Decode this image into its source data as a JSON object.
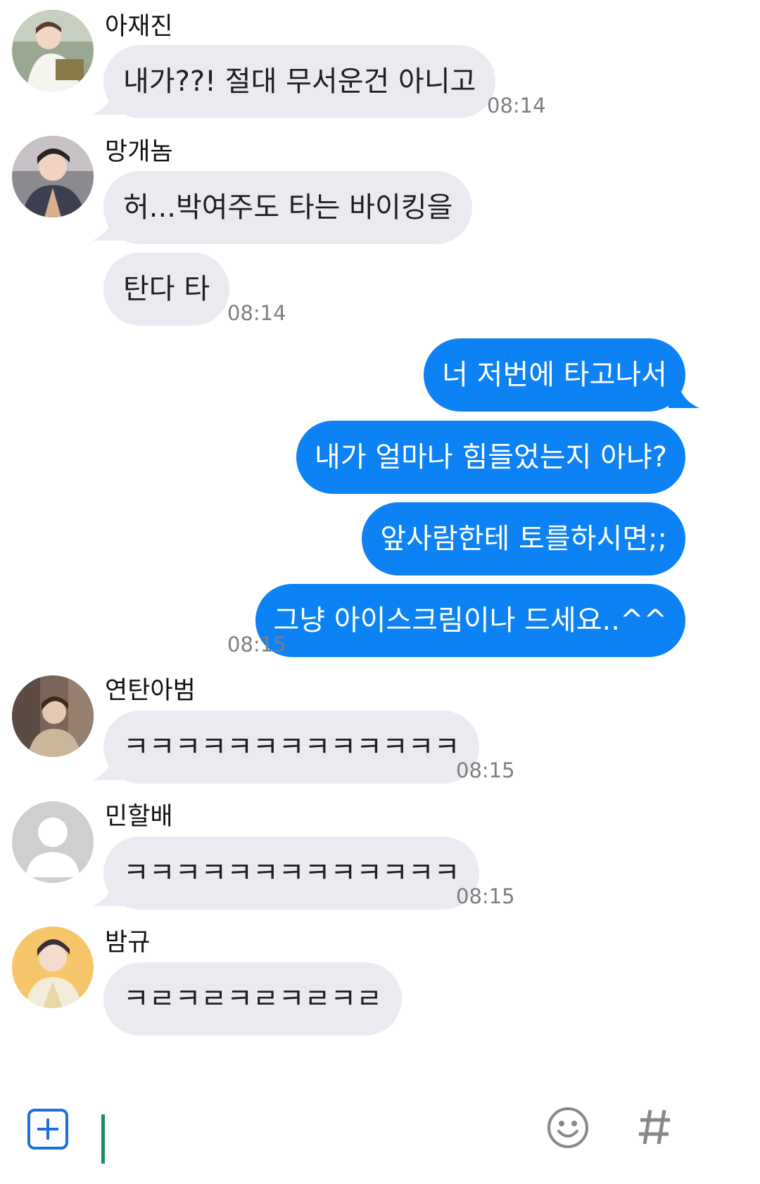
{
  "messages": [
    {
      "sender": "아재진",
      "avatar": "member-photo",
      "bubbles": [
        "내가??! 절대 무서운건 아니고"
      ],
      "time": "08:14"
    },
    {
      "sender": "망개놈",
      "avatar": "member-photo",
      "bubbles": [
        "허...박여주도 타는 바이킹을",
        "탄다 타"
      ],
      "time": "08:14"
    },
    {
      "sender": "me",
      "bubbles": [
        "너 저번에 타고나서",
        "내가 얼마나 힘들었는지 아냐?",
        "앞사람한테 토를하시면;;",
        "그냥 아이스크림이나 드세요..^^"
      ],
      "time": "08:15"
    },
    {
      "sender": "연탄아범",
      "avatar": "member-photo",
      "bubbles": [
        "ㅋㅋㅋㅋㅋㅋㅋㅋㅋㅋㅋㅋㅋ"
      ],
      "time": "08:15"
    },
    {
      "sender": "민할배",
      "avatar": "default-profile-icon",
      "bubbles": [
        "ㅋㅋㅋㅋㅋㅋㅋㅋㅋㅋㅋㅋㅋ"
      ],
      "time": "08:15"
    },
    {
      "sender": "밤규",
      "avatar": "member-photo",
      "bubbles": [
        "ㅋㄹㅋㄹㅋㄹㅋㄹㅋㄹ"
      ]
    }
  ],
  "input_bar": {
    "attach_icon": "plus-square-icon",
    "message_value": "",
    "emoji_icon": "smiley-icon",
    "hashtag_icon": "hashtag-icon"
  },
  "colors": {
    "incoming_bubble": "#eaeaf0",
    "outgoing_bubble": "#0d82f4",
    "timestamp": "#7e7e7e",
    "caret": "#1e8a6e",
    "attach_icon": "#1c6fe0",
    "input_icons": "#888888"
  }
}
